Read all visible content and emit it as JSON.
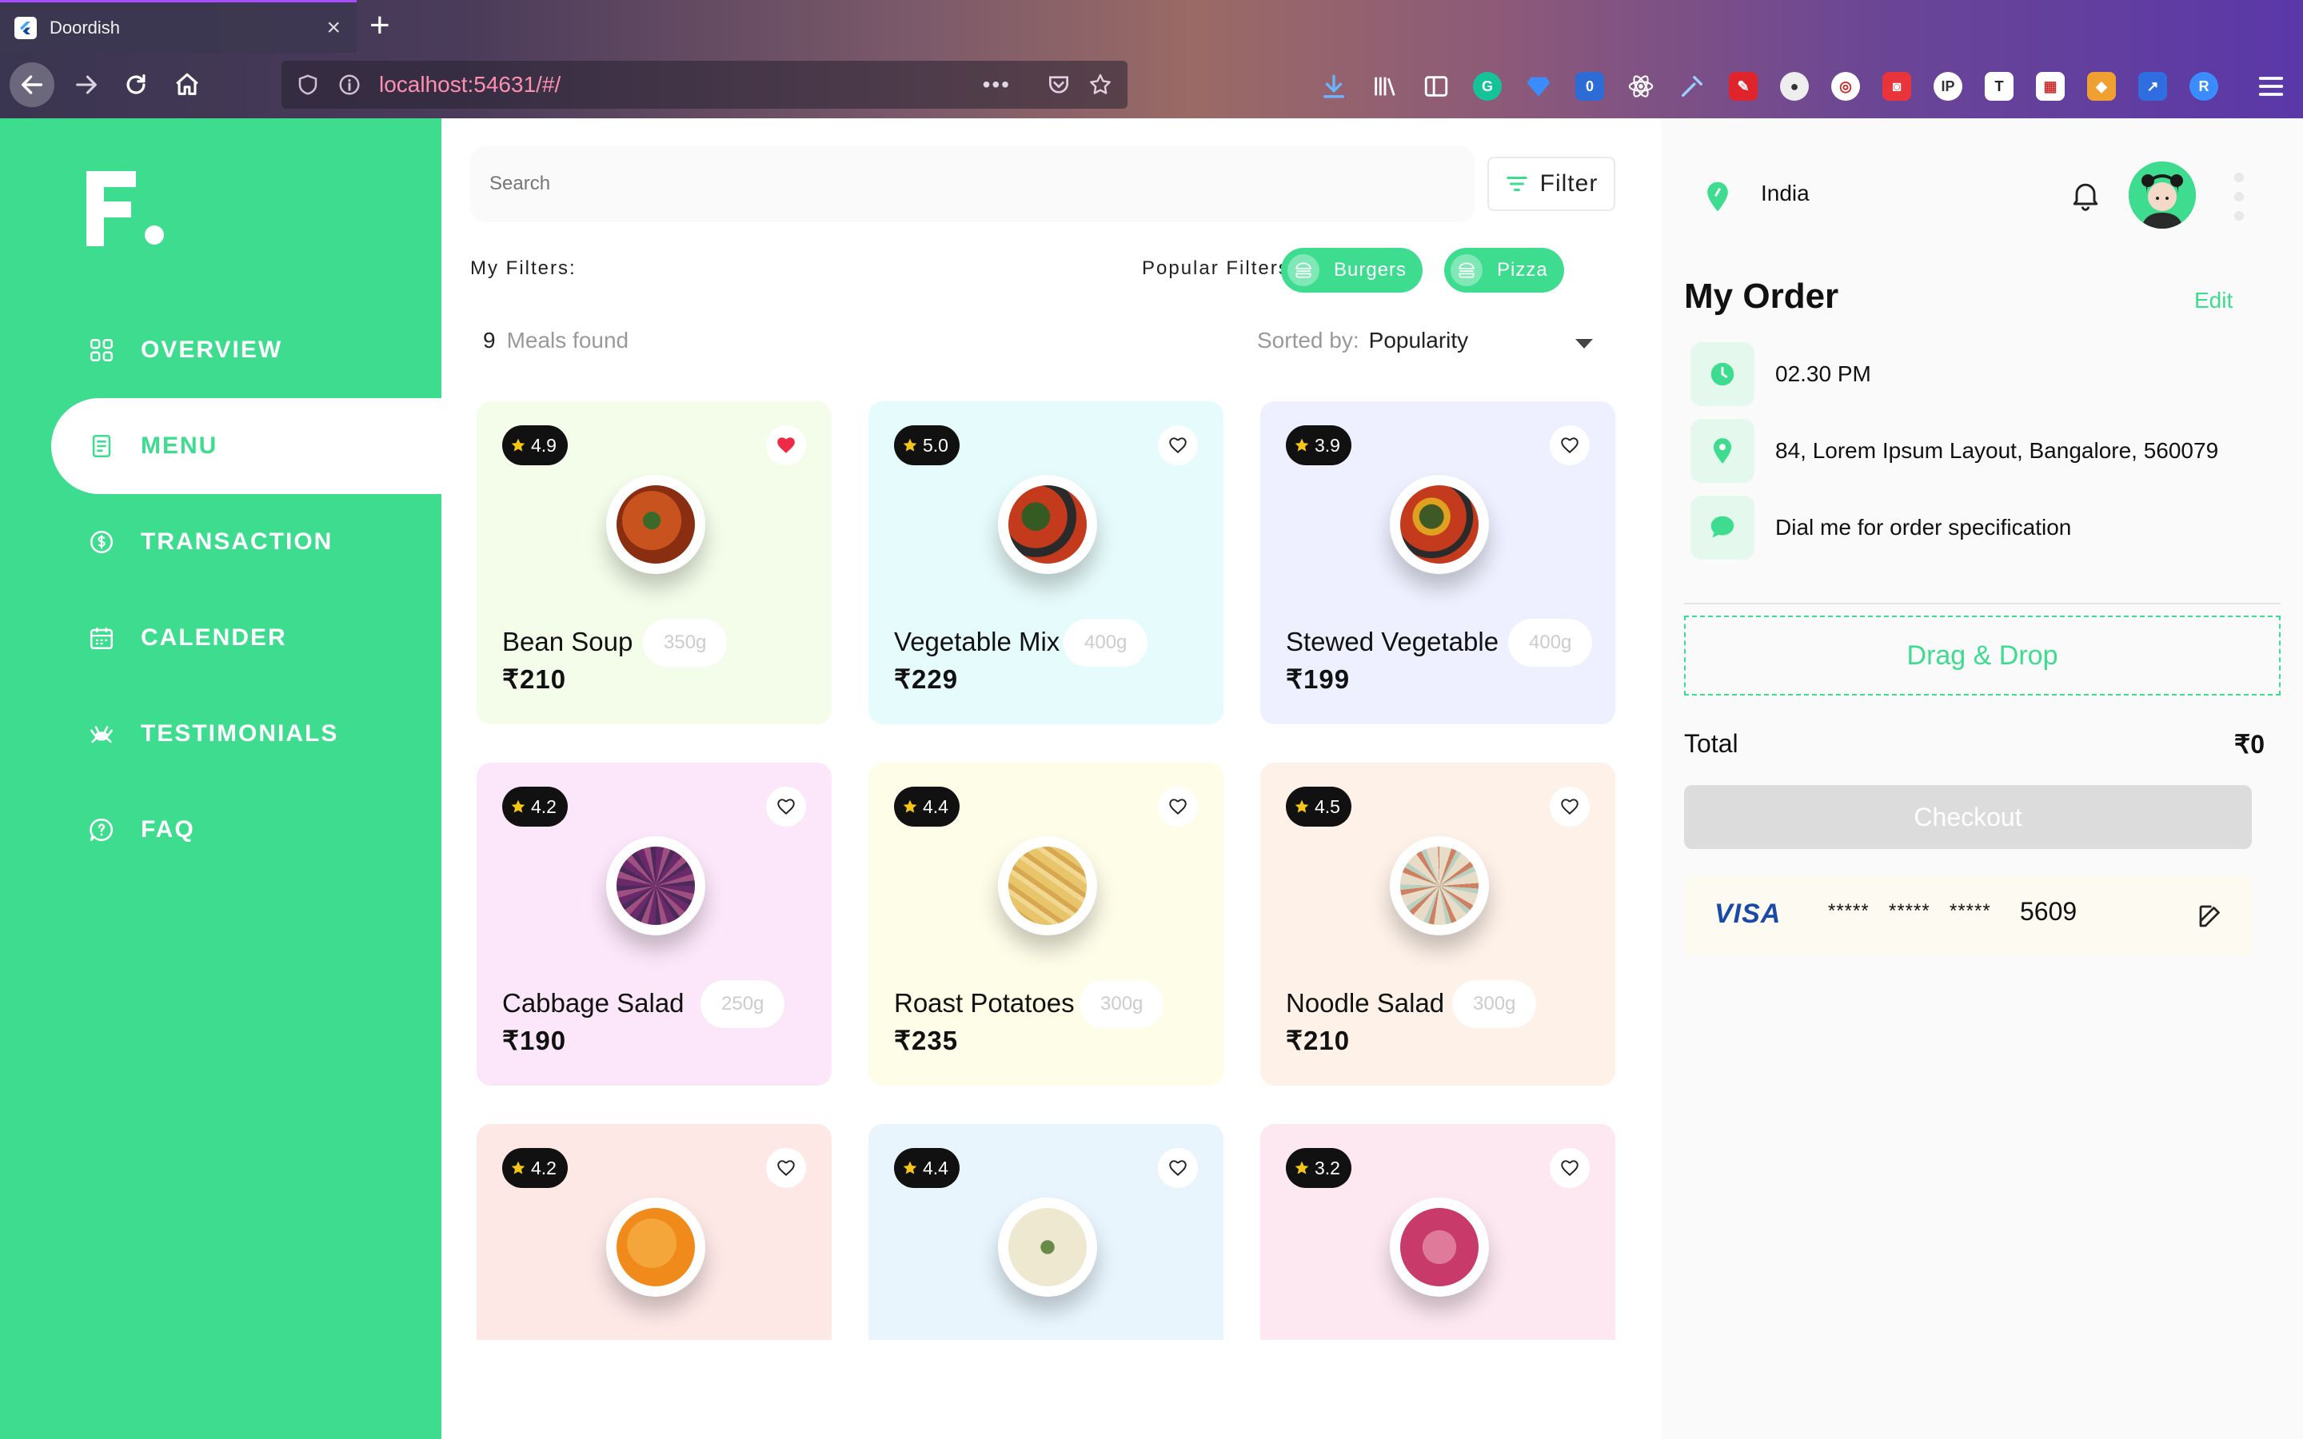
{
  "browser": {
    "tab_title": "Doordish",
    "url": "localhost:54631/#/",
    "url_dots": "•••",
    "new_tab": "+",
    "close": "×"
  },
  "sidebar": {
    "logo_text": "F.",
    "items": [
      {
        "label": "OVERVIEW",
        "icon": "grid-icon",
        "active": false
      },
      {
        "label": "MENU",
        "icon": "document-icon",
        "active": true
      },
      {
        "label": "TRANSACTION",
        "icon": "dollar-icon",
        "active": false
      },
      {
        "label": "CALENDER",
        "icon": "calendar-icon",
        "active": false
      },
      {
        "label": "TESTIMONIALS",
        "icon": "crab-icon",
        "active": false
      },
      {
        "label": "FAQ",
        "icon": "faq-icon",
        "active": false
      }
    ]
  },
  "main": {
    "search_placeholder": "Search",
    "filter_label": "Filter",
    "my_filters_label": "My Filters:",
    "popular_filters_label": "Popular Filters:",
    "popular_filters": [
      "Burgers",
      "Pizza"
    ],
    "meals_count": "9",
    "meals_found_label": "Meals found",
    "sorted_by_label": "Sorted by:",
    "sorted_by_value": "Popularity",
    "meals": [
      {
        "name": "Bean Soup",
        "weight": "350g",
        "price": "₹210",
        "rating": "4.9",
        "favorite": true,
        "bg": "#f4fdea",
        "food_colors": [
          "#8a2e12",
          "#c9531f"
        ]
      },
      {
        "name": "Vegetable Mix",
        "weight": "400g",
        "price": "₹229",
        "rating": "5.0",
        "favorite": false,
        "bg": "#e6fbfb",
        "food_colors": [
          "#c43a1c",
          "#355a22"
        ]
      },
      {
        "name": "Stewed Vegetable",
        "weight": "400g",
        "price": "₹199",
        "rating": "3.9",
        "favorite": false,
        "bg": "#eef0ff",
        "food_colors": [
          "#c43a1c",
          "#3d5a26"
        ]
      },
      {
        "name": "Cabbage Salad",
        "weight": "250g",
        "price": "₹190",
        "rating": "4.2",
        "favorite": false,
        "bg": "#fce7fa",
        "food_colors": [
          "#6a2a6a",
          "#a05080"
        ]
      },
      {
        "name": "Roast Potatoes",
        "weight": "300g",
        "price": "₹235",
        "rating": "4.4",
        "favorite": false,
        "bg": "#fefde8",
        "food_colors": [
          "#e8c46a",
          "#f0d890"
        ]
      },
      {
        "name": "Noodle Salad",
        "weight": "300g",
        "price": "₹210",
        "rating": "4.5",
        "favorite": false,
        "bg": "#fdf1e8",
        "food_colors": [
          "#e6dcc8",
          "#d08060"
        ]
      },
      {
        "name": "",
        "weight": "",
        "price": "",
        "rating": "4.2",
        "favorite": false,
        "bg": "#fde8e6",
        "food_colors": [
          "#f08a1a",
          "#f4a63a"
        ]
      },
      {
        "name": "",
        "weight": "",
        "price": "",
        "rating": "4.4",
        "favorite": false,
        "bg": "#e8f5fd",
        "food_colors": [
          "#eee8d0",
          "#6a8a4a"
        ]
      },
      {
        "name": "",
        "weight": "",
        "price": "",
        "rating": "3.2",
        "favorite": false,
        "bg": "#fde8f2",
        "food_colors": [
          "#c83a6a",
          "#e07a9a"
        ]
      }
    ]
  },
  "right_panel": {
    "location": "India",
    "order_title": "My Order",
    "edit_label": "Edit",
    "time": "02.30 PM",
    "address": "84, Lorem Ipsum Layout, Bangalore, 560079",
    "note": "Dial me for order specification",
    "drop_label": "Drag & Drop",
    "total_label": "Total",
    "total_value": "₹0",
    "checkout_label": "Checkout",
    "card_brand": "VISA",
    "card_mask": [
      "*****",
      "*****",
      "*****"
    ],
    "card_last4": "5609"
  },
  "colors": {
    "accent": "#3ddc8f",
    "sidebar_bg": "#3ddc8f",
    "heart_active": "#ee2b47",
    "star": "#f5c518"
  }
}
